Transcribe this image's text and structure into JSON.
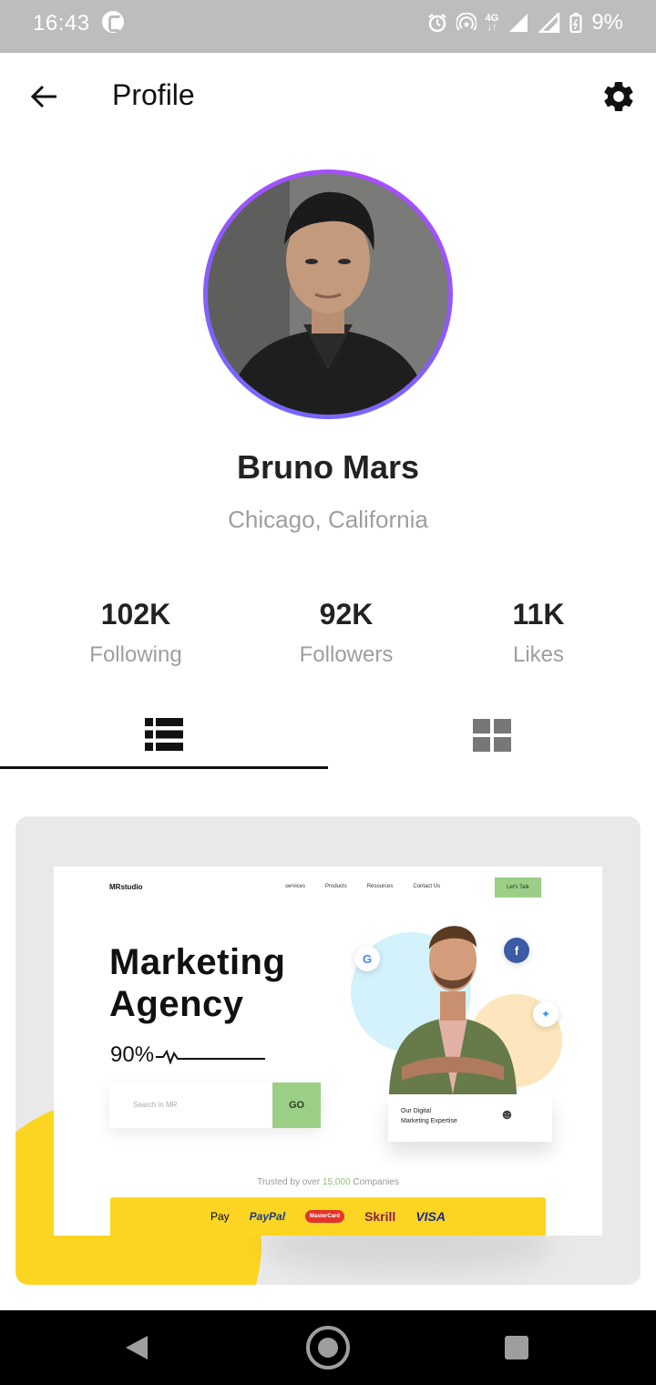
{
  "status_bar": {
    "time": "16:43",
    "network": "4G",
    "battery": "9%"
  },
  "header": {
    "title": "Profile",
    "back_icon": "arrow-left-icon",
    "settings_icon": "gear-icon"
  },
  "profile": {
    "name": "Bruno Mars",
    "location": "Chicago, California"
  },
  "stats": [
    {
      "value": "102K",
      "label": "Following"
    },
    {
      "value": "92K",
      "label": "Followers"
    },
    {
      "value": "11K",
      "label": "Likes"
    }
  ],
  "tabs": [
    {
      "icon": "list-view-icon",
      "active": true
    },
    {
      "icon": "grid-view-icon",
      "active": false
    }
  ],
  "post": {
    "logo": "MRstudio",
    "nav": [
      "services",
      "Products",
      "Resources",
      "Contact Us"
    ],
    "cta": "Let's Talk",
    "headline_line1": "Marketing",
    "headline_line2": "Agency",
    "stat": "90%",
    "search_placeholder": "Search in MR",
    "go_label": "GO",
    "expertise_line1": "Our Digital",
    "expertise_line2": "Marketing Expertise",
    "trusted_prefix": "Trusted by over ",
    "trusted_count": "15,000",
    "trusted_suffix": " Companies",
    "payments": [
      "Pay",
      "PayPal",
      "MasterCard",
      "Skrill",
      "VISA"
    ]
  },
  "colors": {
    "accent_ring_start": "#b04bff",
    "accent_ring_end": "#6d6bff",
    "cta_green": "#9ccf86",
    "brand_yellow": "#fcd523"
  }
}
